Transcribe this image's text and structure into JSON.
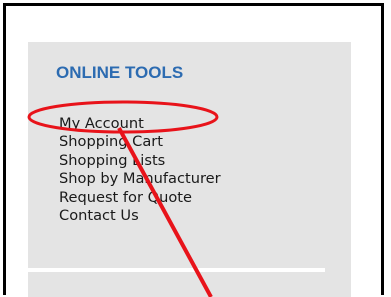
{
  "online_tools": {
    "title": "ONLINE TOOLS",
    "items": [
      {
        "label": "My Account"
      },
      {
        "label": "Shopping Cart"
      },
      {
        "label": "Shopping Lists"
      },
      {
        "label": "Shop by Manufacturer"
      },
      {
        "label": "Request for Quote"
      },
      {
        "label": "Contact Us"
      }
    ]
  },
  "colors": {
    "title": "#2c6bb1",
    "panel_background": "#e4e4e4",
    "annotation": "#e8131a",
    "frame_border": "#000000"
  },
  "annotation": {
    "highlighted_item": "My Account",
    "marks": [
      "highlight-ellipse",
      "pointer-arrow"
    ]
  }
}
